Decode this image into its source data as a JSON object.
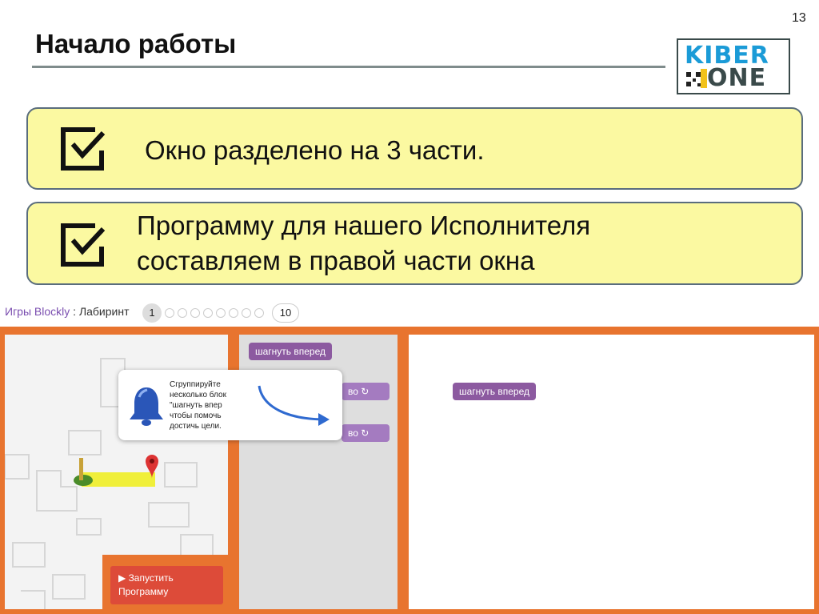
{
  "slide": {
    "number": "13",
    "title": "Начало работы"
  },
  "logo": {
    "line1": "KIBER",
    "line2": "ONE"
  },
  "points": [
    {
      "text": "Окно разделено на 3 части."
    },
    {
      "text_line1": "Программу для нашего Исполнителя",
      "text_line2": "составляем в правой части окна"
    }
  ],
  "game": {
    "title_prefix": "Игры Blockly",
    "title_sep": " : ",
    "title_level": "Лабиринт",
    "level_current": "1",
    "level_last": "10"
  },
  "toolbox": {
    "block_forward": "шагнуть вперед",
    "block_turn1": "во ↻",
    "block_turn2": "во ↻"
  },
  "tooltip": {
    "line1": "Сгруппируйте",
    "line2": "несколько блок",
    "line3": "\"шагнуть впер",
    "line4": "чтобы помочь",
    "line5": "достичь цели."
  },
  "workspace": {
    "block_forward": "шагнуть вперед"
  },
  "run_button": {
    "line1": "Запустить",
    "line2": "Программу"
  },
  "colors": {
    "orange": "#e8742f",
    "block": "#8c5aa0",
    "box_bg": "#fbf9a1",
    "run": "#dd4b39"
  }
}
